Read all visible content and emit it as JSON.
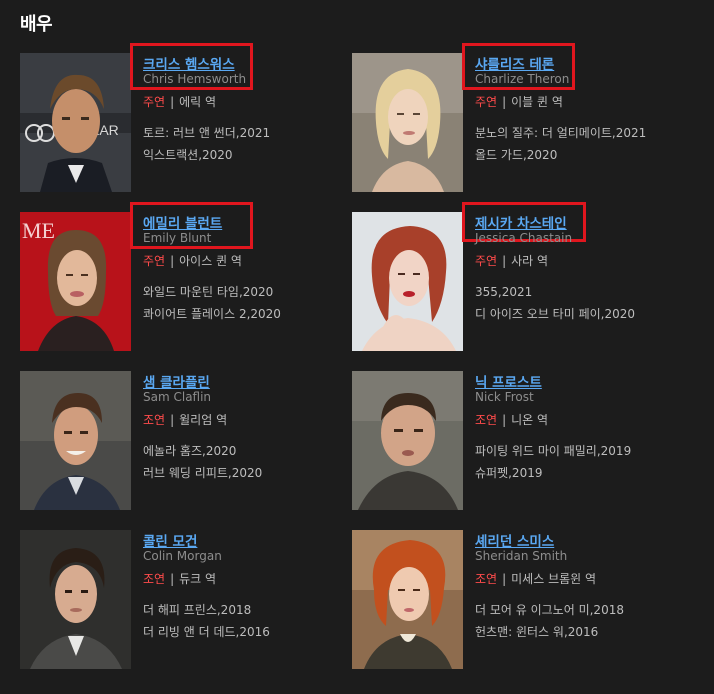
{
  "section": {
    "title": "배우"
  },
  "actors": [
    {
      "ko": "크리스 헴스워스",
      "en": "Chris Hemsworth",
      "role_type": "주연",
      "role": "에릭 역",
      "works": [
        "토르: 러브 앤 썬더,2021",
        "익스트랙션,2020"
      ],
      "highlighted": true
    },
    {
      "ko": "샤를리즈 테론",
      "en": "Charlize Theron",
      "role_type": "주연",
      "role": "이블 퀸 역",
      "works": [
        "분노의 질주: 더 얼티메이트,2021",
        "올드 가드,2020"
      ],
      "highlighted": true
    },
    {
      "ko": "에밀리 블런트",
      "en": "Emily Blunt",
      "role_type": "주연",
      "role": "아이스 퀸 역",
      "works": [
        "와일드 마운틴 타임,2020",
        "콰이어트 플레이스 2,2020"
      ],
      "highlighted": true
    },
    {
      "ko": "제시카 차스테인",
      "en": "Jessica Chastain",
      "role_type": "주연",
      "role": "사라 역",
      "works": [
        "355,2021",
        "디 아이즈 오브 타미 페이,2020"
      ],
      "highlighted": true
    },
    {
      "ko": "샘 클라플린",
      "en": "Sam Claflin",
      "role_type": "조연",
      "role": "윌리엄 역",
      "works": [
        "에놀라 홈즈,2020",
        "러브 웨딩 리피트,2020"
      ],
      "highlighted": false
    },
    {
      "ko": "닉 프로스트",
      "en": "Nick Frost",
      "role_type": "조연",
      "role": "니온 역",
      "works": [
        "파이팅 위드 마이 패밀리,2019",
        "슈퍼펫,2019"
      ],
      "highlighted": false
    },
    {
      "ko": "콜린 모건",
      "en": "Colin Morgan",
      "role_type": "조연",
      "role": "듀크 역",
      "works": [
        "더 해피 프린스,2018",
        "더 리빙 앤 더 데드,2016"
      ],
      "highlighted": false
    },
    {
      "ko": "셰리던 스미스",
      "en": "Sheridan Smith",
      "role_type": "조연",
      "role": "미세스 브롬윈 역",
      "works": [
        "더 모어 유 이그노어 미,2018",
        "헌츠맨: 윈터스 워,2016"
      ],
      "highlighted": false
    }
  ],
  "role_separator": "|"
}
